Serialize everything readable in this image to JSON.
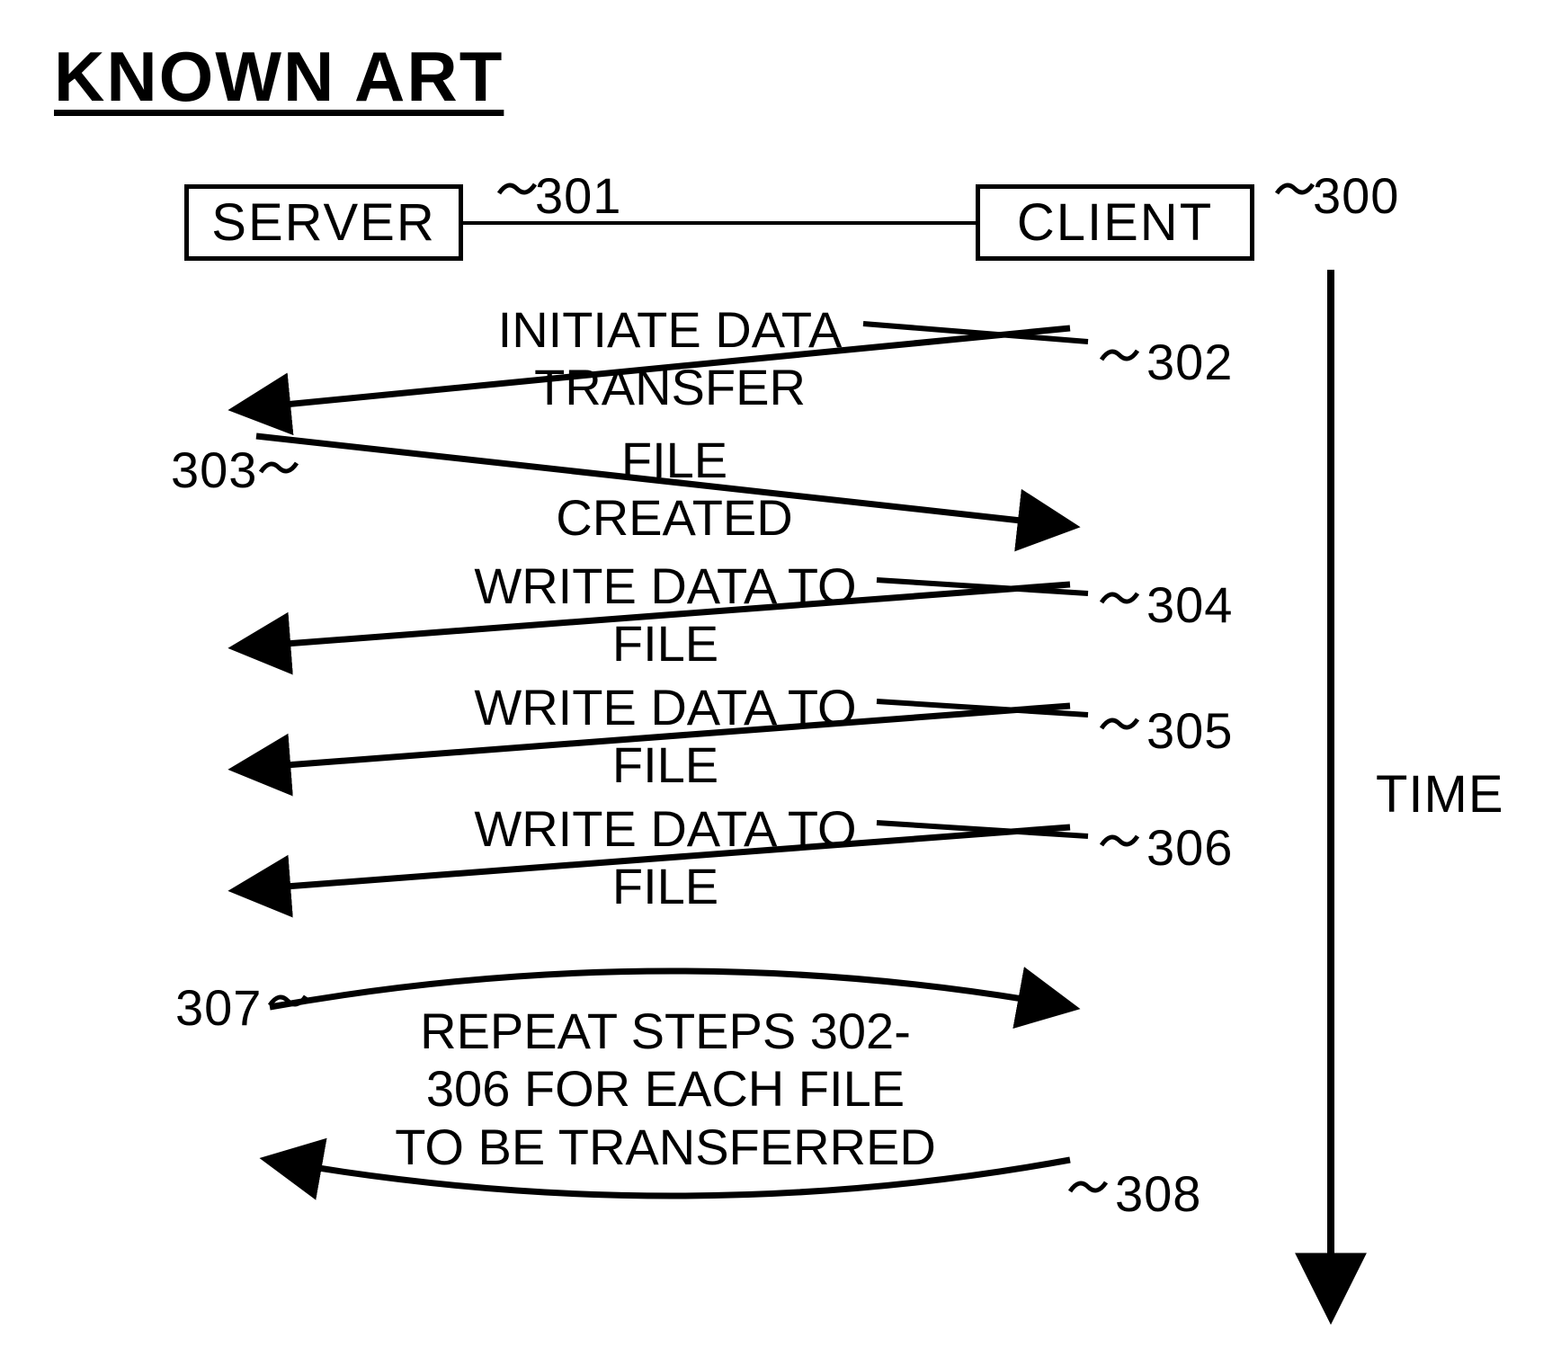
{
  "heading": "KNOWN ART",
  "nodes": {
    "server": {
      "label": "SERVER",
      "ref": "301"
    },
    "client": {
      "label": "CLIENT",
      "ref": "300"
    }
  },
  "axis": {
    "label": "TIME"
  },
  "messages": {
    "m302": {
      "text": "INITIATE DATA\nTRANSFER",
      "ref": "302"
    },
    "m303": {
      "text": "FILE\nCREATED",
      "ref": "303"
    },
    "m304": {
      "text": "WRITE DATA TO\nFILE",
      "ref": "304"
    },
    "m305": {
      "text": "WRITE DATA TO\nFILE",
      "ref": "305"
    },
    "m306": {
      "text": "WRITE DATA TO\nFILE",
      "ref": "306"
    },
    "repeat": {
      "text": "REPEAT STEPS 302-\n306 FOR EACH FILE\nTO BE TRANSFERRED",
      "ref_left": "307",
      "ref_right": "308"
    }
  }
}
